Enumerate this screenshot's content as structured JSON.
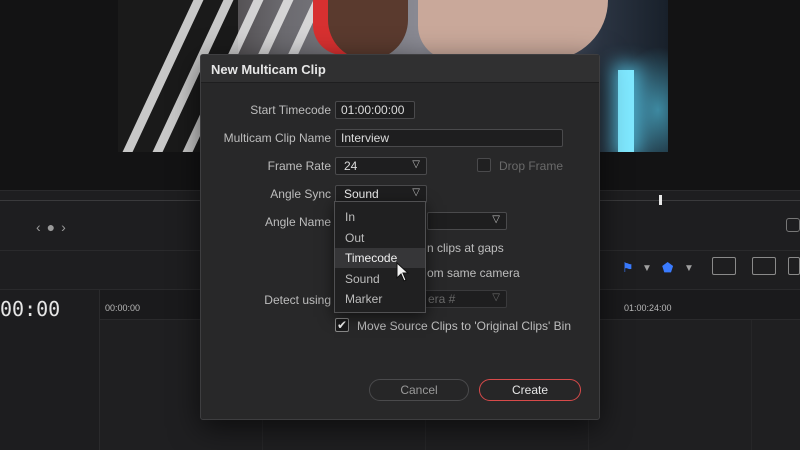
{
  "dialog": {
    "title": "New Multicam Clip",
    "fields": {
      "start_timecode": {
        "label": "Start Timecode",
        "value": "01:00:00:00"
      },
      "clip_name": {
        "label": "Multicam Clip Name",
        "value": "Interview"
      },
      "frame_rate": {
        "label": "Frame Rate",
        "value": "24"
      },
      "drop_frame": {
        "label": "Drop Frame",
        "checked": false
      },
      "angle_sync": {
        "label": "Angle Sync",
        "value": "Sound"
      },
      "angle_name": {
        "label": "Angle Name",
        "value": ""
      },
      "gaps_option": {
        "label_visible": "n clips at gaps"
      },
      "same_camera_option": {
        "label_visible": "om same camera"
      },
      "detect_using": {
        "label": "Detect using",
        "value_visible": "era #"
      },
      "move_source": {
        "label": "Move Source Clips to 'Original Clips' Bin",
        "checked": true
      }
    },
    "buttons": {
      "cancel": "Cancel",
      "create": "Create"
    },
    "accent_color": "#d84a4a"
  },
  "angle_sync_menu": {
    "items": [
      "In",
      "Out",
      "Timecode",
      "Sound",
      "Marker"
    ],
    "hovered_index": 2
  },
  "timeline": {
    "timecode": "00:00",
    "ruler_labels": [
      "00:00:00",
      "01:00:24:00"
    ]
  },
  "icons": {
    "checkmark": "✔",
    "caret": "⌄",
    "flag": "flag-icon",
    "marker": "marker-icon"
  }
}
